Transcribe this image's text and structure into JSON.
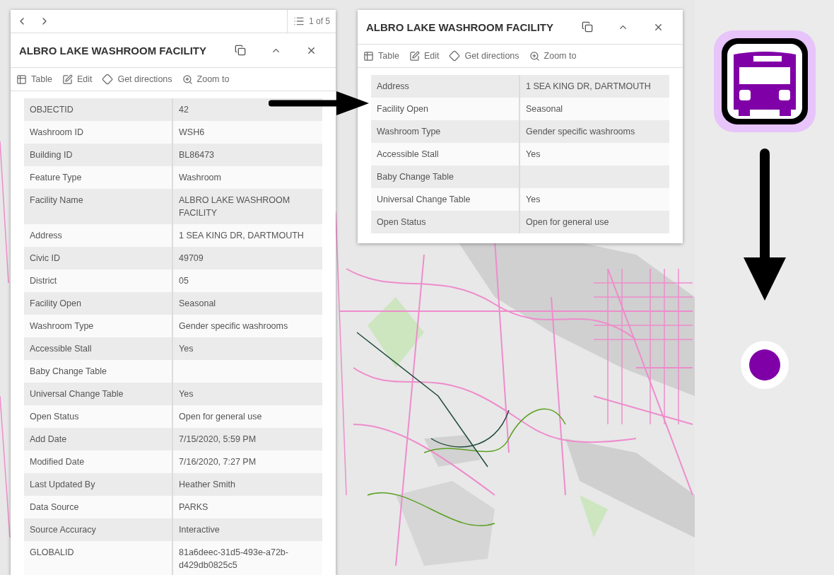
{
  "popups": [
    {
      "pager": {
        "count": "1 of 5"
      },
      "title": "ALBRO LAKE WASHROOM FACILITY",
      "actions": [
        {
          "kind": "table",
          "label": "Table"
        },
        {
          "kind": "edit",
          "label": "Edit"
        },
        {
          "kind": "directions",
          "label": "Get directions"
        },
        {
          "kind": "zoom",
          "label": "Zoom to"
        }
      ],
      "rows": [
        {
          "label": "OBJECTID",
          "value": "42"
        },
        {
          "label": "Washroom ID",
          "value": "WSH6"
        },
        {
          "label": "Building ID",
          "value": "BL86473"
        },
        {
          "label": "Feature Type",
          "value": "Washroom"
        },
        {
          "label": "Facility Name",
          "value": "ALBRO LAKE WASHROOM FACILITY"
        },
        {
          "label": "Address",
          "value": "1 SEA KING DR, DARTMOUTH"
        },
        {
          "label": "Civic ID",
          "value": "49709"
        },
        {
          "label": "District",
          "value": "05"
        },
        {
          "label": "Facility Open",
          "value": "Seasonal"
        },
        {
          "label": "Washroom Type",
          "value": "Gender specific washrooms"
        },
        {
          "label": "Accessible Stall",
          "value": "Yes"
        },
        {
          "label": "Baby Change Table"
        },
        {
          "label": "Universal Change Table",
          "value": "Yes"
        },
        {
          "label": "Open Status",
          "value": "Open for general use"
        },
        {
          "label": "Add Date",
          "value": "7/15/2020, 5:59 PM"
        },
        {
          "label": "Modified Date",
          "value": "7/16/2020, 7:27 PM"
        },
        {
          "label": "Last Updated By",
          "value": "Heather Smith"
        },
        {
          "label": "Data Source",
          "value": "PARKS"
        },
        {
          "label": "Source Accuracy",
          "value": "Interactive"
        },
        {
          "label": "GLOBALID",
          "value": "81a6deec-31d5-493e-a72b-d429db0825c5"
        }
      ]
    },
    {
      "title": "ALBRO LAKE WASHROOM FACILITY",
      "actions": [
        {
          "kind": "table",
          "label": "Table"
        },
        {
          "kind": "edit",
          "label": "Edit"
        },
        {
          "kind": "directions",
          "label": "Get directions"
        },
        {
          "kind": "zoom",
          "label": "Zoom to"
        }
      ],
      "rows": [
        {
          "label": "Address",
          "value": "1 SEA KING DR, DARTMOUTH"
        },
        {
          "label": "Facility Open",
          "value": "Seasonal"
        },
        {
          "label": "Washroom Type",
          "value": "Gender specific washrooms"
        },
        {
          "label": "Accessible Stall",
          "value": "Yes"
        },
        {
          "label": "Baby Change Table"
        },
        {
          "label": "Universal Change Table",
          "value": "Yes"
        },
        {
          "label": "Open Status",
          "value": "Open for general use"
        }
      ]
    }
  ]
}
